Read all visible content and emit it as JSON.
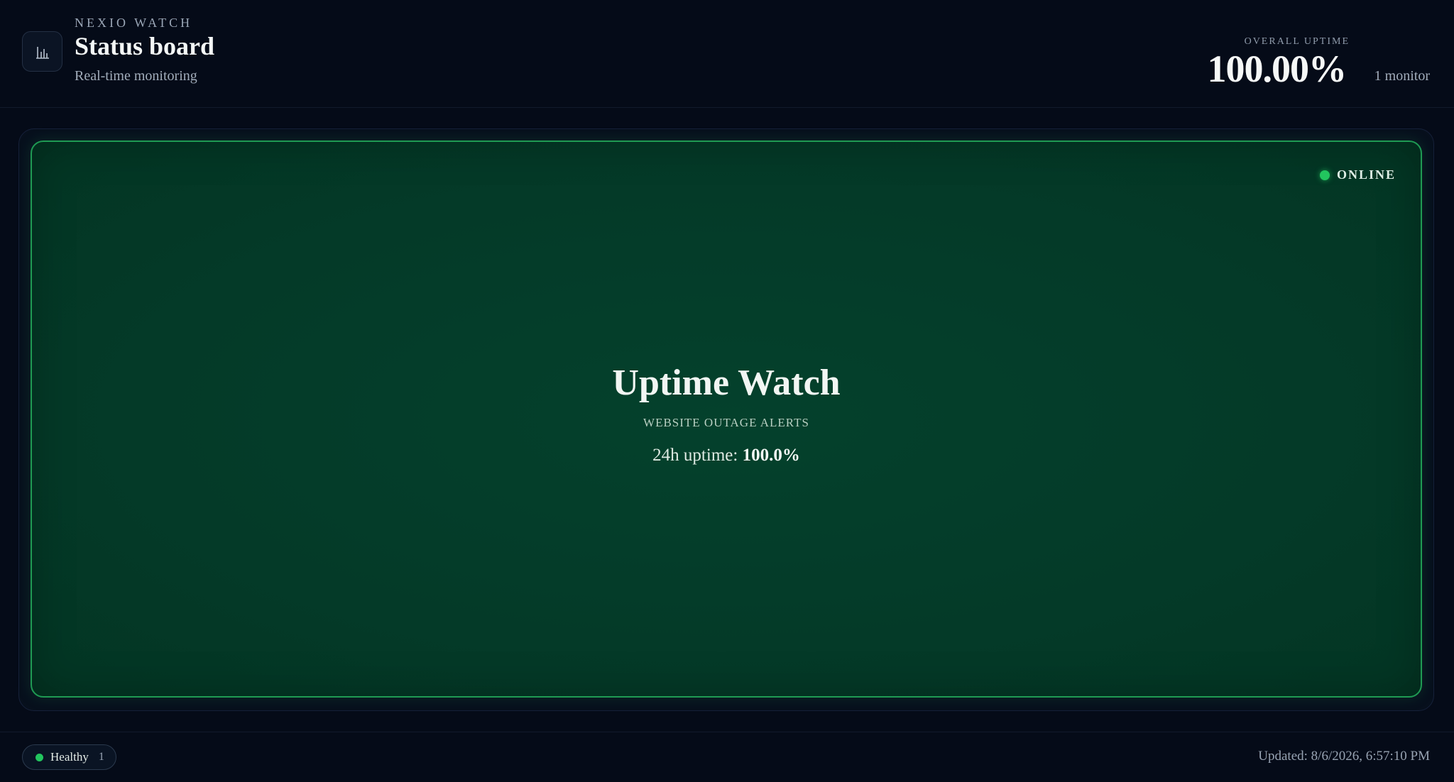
{
  "header": {
    "brand": "NEXIO WATCH",
    "title": "Status board",
    "subtitle": "Real-time monitoring",
    "logo_icon": "bar-chart-icon",
    "overall_uptime_label": "OVERALL UPTIME",
    "overall_uptime_value": "100.00%",
    "monitor_count": "1 monitor"
  },
  "monitor": {
    "status": "ONLINE",
    "status_color": "#22c55e",
    "name": "Uptime Watch",
    "description": "WEBSITE OUTAGE ALERTS",
    "uptime_prefix": "24h uptime:",
    "uptime_value": "100.0%"
  },
  "footer": {
    "healthy_label": "Healthy",
    "healthy_count": "1",
    "updated": "Updated: 8/6/2026, 6:57:10 PM"
  },
  "colors": {
    "background": "#050b18",
    "card_background": "#043a28",
    "card_border": "#1f9a53",
    "accent_green": "#22c55e"
  }
}
